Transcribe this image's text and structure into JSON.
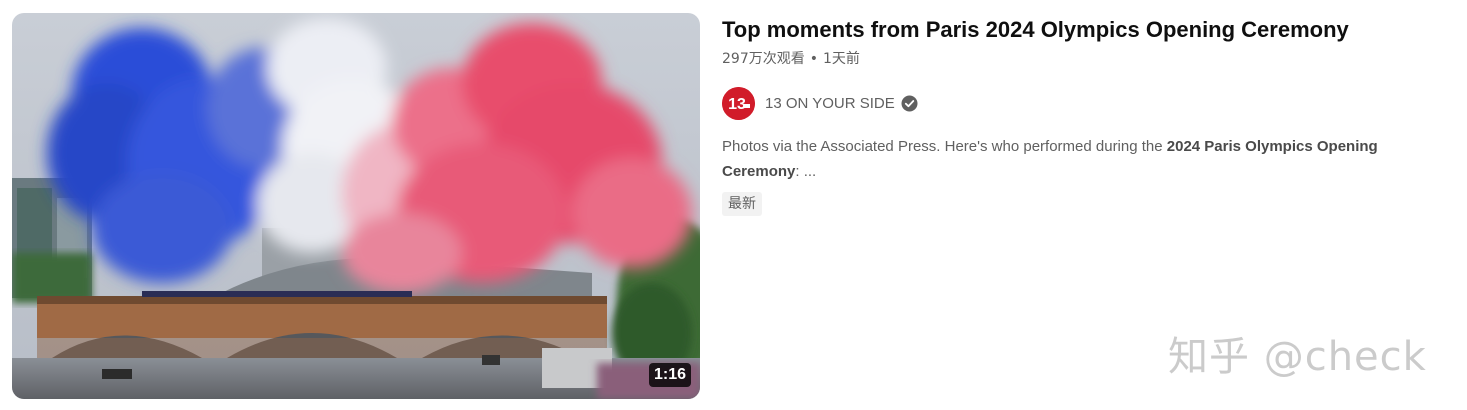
{
  "video": {
    "title": "Top moments from Paris 2024 Olympics Opening Ceremony",
    "views": "297万次观看",
    "separator": "•",
    "age": "1天前",
    "duration": "1:16",
    "channel": {
      "name": "13 ON YOUR SIDE",
      "avatar_text": "13",
      "avatar_color": "#d11c2a",
      "verified_icon": "verified-check-icon"
    },
    "description": {
      "prefix": "Photos via the Associated Press. Here's who performed during the ",
      "highlight_1": "2024 Paris Olympics Opening",
      "highlight_2": "Ceremony",
      "suffix": ": ..."
    },
    "badge": "最新"
  },
  "watermark": "知乎 @check",
  "colors": {
    "smoke_blue": "#2f4fd6",
    "smoke_white": "#eef0f4",
    "smoke_red": "#e8506f",
    "text_primary": "#0f0f0f",
    "text_secondary": "#606060"
  }
}
